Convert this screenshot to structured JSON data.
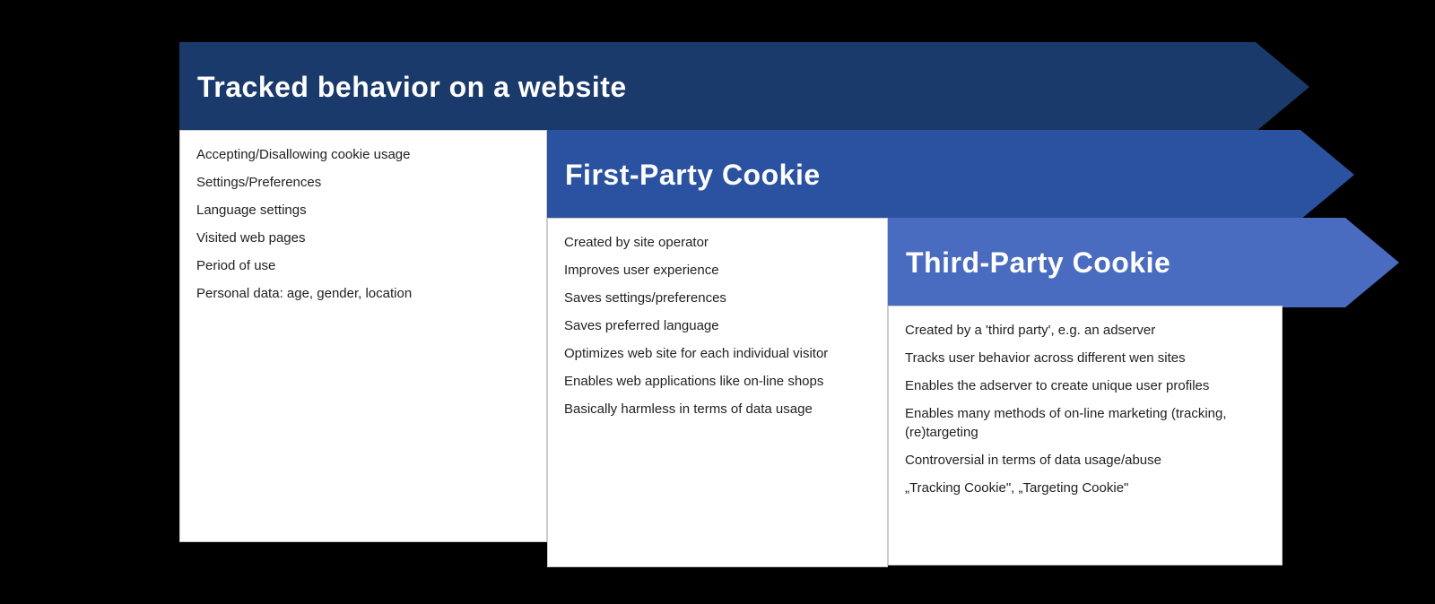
{
  "arrows": {
    "arrow1": {
      "label": "Tracked behavior on a website"
    },
    "arrow2": {
      "label": "First-Party Cookie"
    },
    "arrow3": {
      "label": "Third-Party Cookie"
    }
  },
  "box1": {
    "items": [
      "Accepting/Disallowing cookie usage",
      "Settings/Preferences",
      "Language settings",
      "Visited web pages",
      "Period of use",
      "Personal data: age, gender, location"
    ]
  },
  "box2": {
    "items": [
      "Created by site operator",
      "Improves user experience",
      "Saves settings/preferences",
      "Saves preferred language",
      "Optimizes web site for each individual visitor",
      "Enables web applications like on-line shops",
      "Basically harmless in terms of data usage"
    ]
  },
  "box3": {
    "items": [
      "Created by a 'third party', e.g. an adserver",
      "Tracks user behavior across different wen sites",
      "Enables the adserver to create unique user profiles",
      "Enables many methods of on-line marketing (tracking, (re)targeting",
      "Controversial in terms of data usage/abuse",
      "„Tracking Cookie\", „Targeting Cookie\""
    ]
  }
}
